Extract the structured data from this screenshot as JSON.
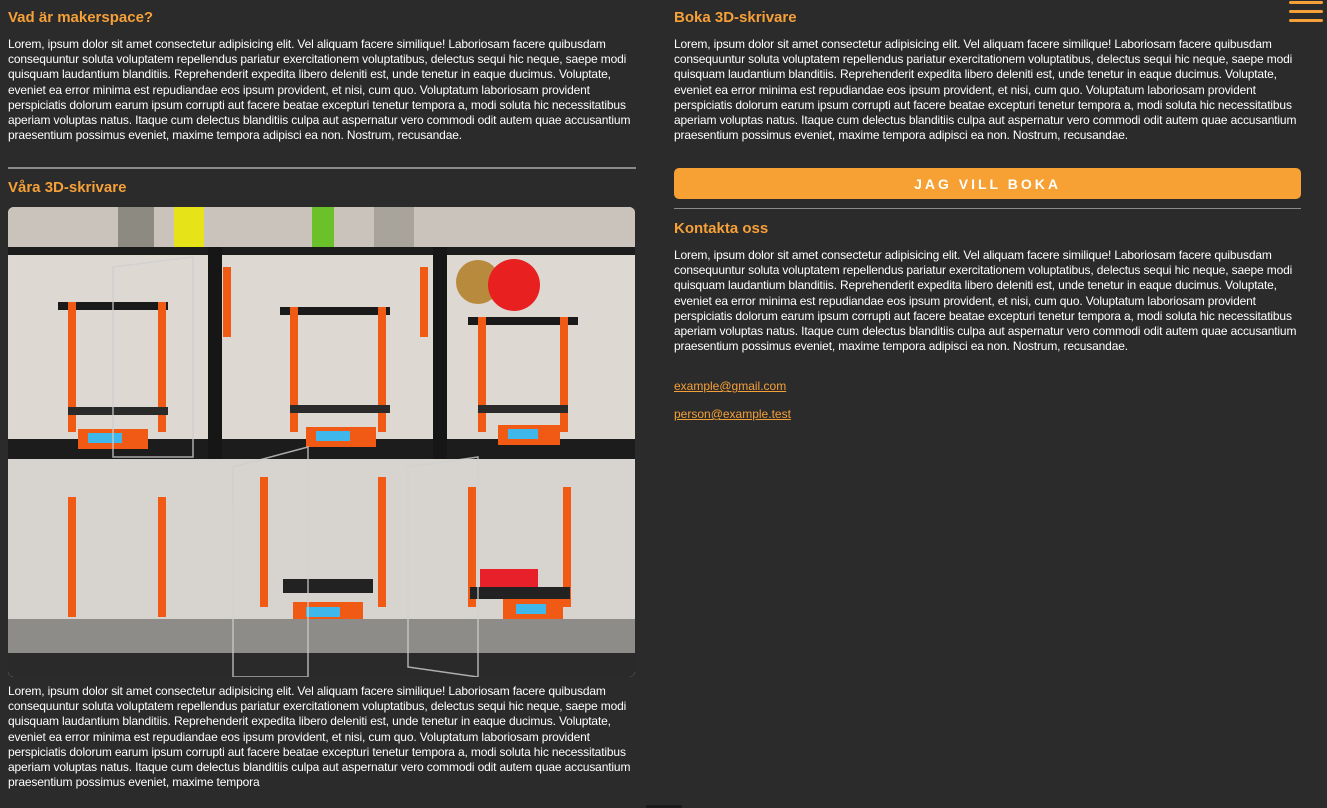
{
  "sections": {
    "makerspace": {
      "title": "Vad är makerspace?",
      "text": "Lorem, ipsum dolor sit amet consectetur adipisicing elit. Vel aliquam facere similique! Laboriosam facere quibusdam consequuntur soluta voluptatem repellendus pariatur exercitationem voluptatibus, delectus sequi hic neque, saepe modi quisquam laudantium blanditiis. Reprehenderit expedita libero deleniti est, unde tenetur in eaque ducimus. Voluptate, eveniet ea error minima est repudiandae eos ipsum provident, et nisi, cum quo. Voluptatum laboriosam provident perspiciatis dolorum earum ipsum corrupti aut facere beatae excepturi tenetur tempora a, modi soluta hic necessitatibus aperiam voluptas natus. Itaque cum delectus blanditiis culpa aut aspernatur vero commodi odit autem quae accusantium praesentium possimus eveniet, maxime tempora adipisci ea non. Nostrum, recusandae."
    },
    "printers": {
      "title": "Våra 3D-skrivare",
      "text": "Lorem, ipsum dolor sit amet consectetur adipisicing elit. Vel aliquam facere similique! Laboriosam facere quibusdam consequuntur soluta voluptatem repellendus pariatur exercitationem voluptatibus, delectus sequi hic neque, saepe modi quisquam laudantium blanditiis. Reprehenderit expedita libero deleniti est, unde tenetur in eaque ducimus. Voluptate, eveniet ea error minima est repudiandae eos ipsum provident, et nisi, cum quo. Voluptatum laboriosam provident perspiciatis dolorum earum ipsum corrupti aut facere beatae excepturi tenetur tempora a, modi soluta hic necessitatibus aperiam voluptas natus. Itaque cum delectus blanditiis culpa aut aspernatur vero commodi odit autem quae accusantium praesentium possimus eveniet, maxime tempora"
    },
    "booking": {
      "title": "Boka 3D-skrivare",
      "text": "Lorem, ipsum dolor sit amet consectetur adipisicing elit. Vel aliquam facere similique! Laboriosam facere quibusdam consequuntur soluta voluptatem repellendus pariatur exercitationem voluptatibus, delectus sequi hic neque, saepe modi quisquam laudantium blanditiis. Reprehenderit expedita libero deleniti est, unde tenetur in eaque ducimus. Voluptate, eveniet ea error minima est repudiandae eos ipsum provident, et nisi, cum quo. Voluptatum laboriosam provident perspiciatis dolorum earum ipsum corrupti aut facere beatae excepturi tenetur tempora a, modi soluta hic necessitatibus aperiam voluptas natus. Itaque cum delectus blanditiis culpa aut aspernatur vero commodi odit autem quae accusantium praesentium possimus eveniet, maxime tempora adipisci ea non. Nostrum, recusandae.",
      "button_label": "JAG VILL BOKA"
    },
    "contact": {
      "title": "Kontakta oss",
      "text": "Lorem, ipsum dolor sit amet consectetur adipisicing elit. Vel aliquam facere similique! Laboriosam facere quibusdam consequuntur soluta voluptatem repellendus pariatur exercitationem voluptatibus, delectus sequi hic neque, saepe modi quisquam laudantium blanditiis. Reprehenderit expedita libero deleniti est, unde tenetur in eaque ducimus. Voluptate, eveniet ea error minima est repudiandae eos ipsum provident, et nisi, cum quo. Voluptatum laboriosam provident perspiciatis dolorum earum ipsum corrupti aut facere beatae excepturi tenetur tempora a, modi soluta hic necessitatibus aperiam voluptas natus. Itaque cum delectus blanditiis culpa aut aspernatur vero commodi odit autem quae accusantium praesentium possimus eveniet, maxime tempora adipisci ea non. Nostrum, recusandae.",
      "emails": [
        "example@gmail.com",
        "person@example.test"
      ]
    }
  },
  "menu_icon": "hamburger-menu-icon",
  "colors": {
    "background": "#2b2b2b",
    "accent": "#f5a038",
    "button": "#f7a033",
    "text": "#ffffff",
    "divider": "#8a8a8a"
  }
}
